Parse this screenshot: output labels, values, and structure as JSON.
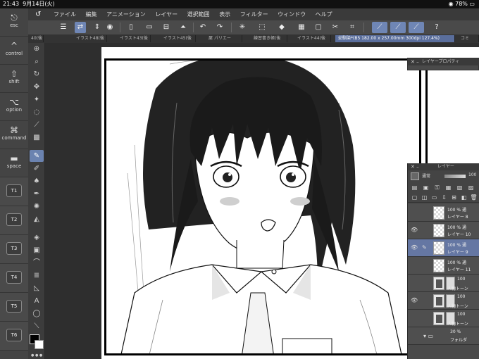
{
  "status": {
    "time": "21:43",
    "date": "9月14日(火)",
    "battery": "78%"
  },
  "menu": {
    "items": [
      "ファイル",
      "編集",
      "アニメーション",
      "レイヤー",
      "選択範囲",
      "表示",
      "フィルター",
      "ウィンドウ",
      "ヘルプ"
    ]
  },
  "keys": [
    {
      "glyph": "⎋",
      "label": "esc"
    },
    {
      "glyph": "^",
      "label": "control"
    },
    {
      "glyph": "⇧",
      "label": "shift"
    },
    {
      "glyph": "⌥",
      "label": "option"
    },
    {
      "glyph": "⌘",
      "label": "command"
    },
    {
      "glyph": "▬",
      "label": "space"
    }
  ],
  "tkeys": [
    "T1",
    "T2",
    "T3",
    "T4",
    "T5",
    "T6"
  ],
  "tabs": [
    "40(後",
    "イラスト48(後",
    "イラスト43(後",
    "イラスト45(後",
    "屋 パリエー",
    "練習書き帳(後",
    "イラスト44(後",
    "幼馴染*(B5 182.00 x 257.00mm 300dpi 127.4%)",
    "コミ"
  ],
  "panels": {
    "layer_property_title": "レイヤープロパティ",
    "layer_title": "レイヤー",
    "blend_mode": "通常",
    "opacity_value": "100"
  },
  "layers": [
    {
      "pct": "100 % 通",
      "name": "レイヤー 8",
      "visible": false,
      "type": "raster"
    },
    {
      "pct": "100 % 通",
      "name": "レイヤー 10",
      "visible": true,
      "type": "raster"
    },
    {
      "pct": "100 % 通",
      "name": "レイヤー 9",
      "visible": true,
      "type": "raster",
      "selected": true
    },
    {
      "pct": "100 % 通",
      "name": "レイヤー 11",
      "visible": false,
      "type": "raster"
    },
    {
      "pct": "100",
      "name": "人物トーン",
      "visible": false,
      "type": "tone"
    },
    {
      "pct": "100",
      "name": "人物トーン",
      "visible": true,
      "type": "tone"
    },
    {
      "pct": "100",
      "name": "人物トーン",
      "visible": false,
      "type": "tone"
    },
    {
      "pct": "30 %",
      "name": "フォルダ",
      "visible": false,
      "type": "folder"
    }
  ]
}
